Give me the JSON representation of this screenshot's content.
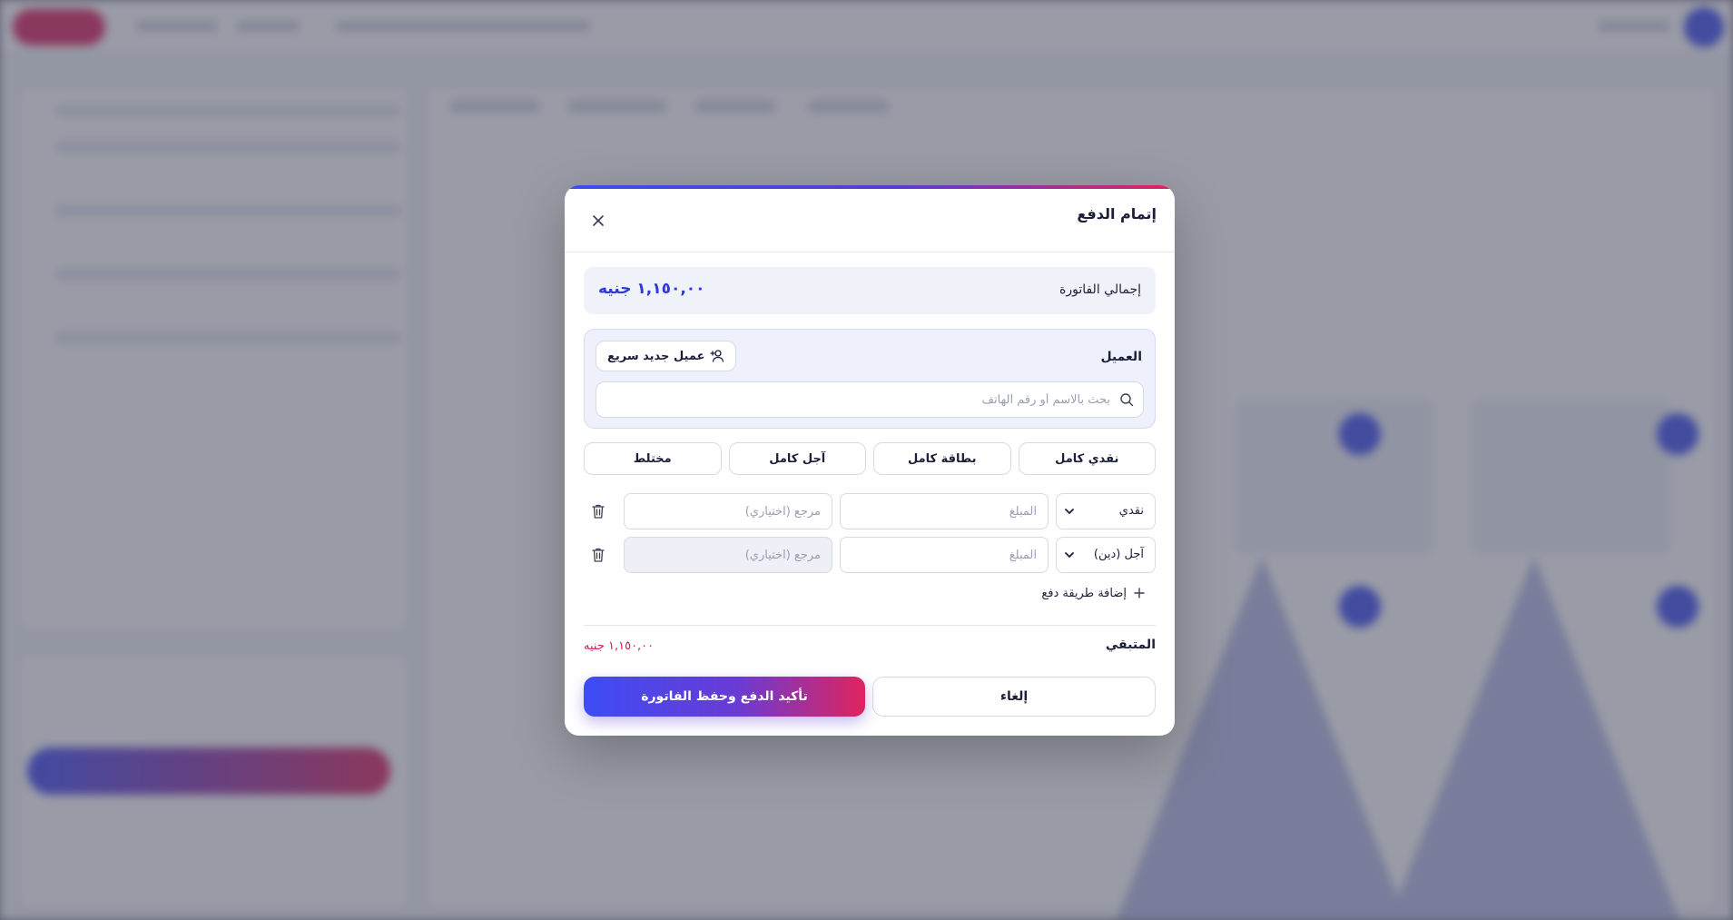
{
  "modal": {
    "title": "إتمام الدفع",
    "close_icon": "close-icon",
    "invoice_total": {
      "label": "إجمالي الفاتورة",
      "value": "١,١٥٠,٠٠ جنيه"
    },
    "customer": {
      "label": "العميل",
      "quick_add_label": "عميل جديد سريع",
      "quick_add_icon": "user-plus-icon",
      "search_placeholder": "بحث بالاسم أو رقم الهاتف",
      "search_value": "",
      "search_icon": "search-icon"
    },
    "payment_modes": [
      "نقدي كامل",
      "بطاقة كامل",
      "آجل كامل",
      "مختلط"
    ],
    "payment_rows": [
      {
        "method": "نقدي",
        "amount_placeholder": "المبلغ",
        "amount_value": "",
        "reference_placeholder": "مرجع (اختياري)",
        "reference_value": "",
        "reference_disabled": false
      },
      {
        "method": "آجل (دين)",
        "amount_placeholder": "المبلغ",
        "amount_value": "",
        "reference_placeholder": "مرجع (اختياري)",
        "reference_value": "",
        "reference_disabled": true
      }
    ],
    "add_method_label": "إضافة طريقة دفع",
    "remaining": {
      "label": "المتبقي",
      "value": "١,١٥٠,٠٠ جنيه"
    },
    "buttons": {
      "cancel": "إلغاء",
      "confirm": "تأكيد الدفع وحفظ الفاتورة"
    }
  },
  "colors": {
    "accent_blue": "#3038d8",
    "accent_red": "#d11d4f",
    "gradient_start": "#3c4cf6",
    "gradient_end": "#e0245e"
  }
}
